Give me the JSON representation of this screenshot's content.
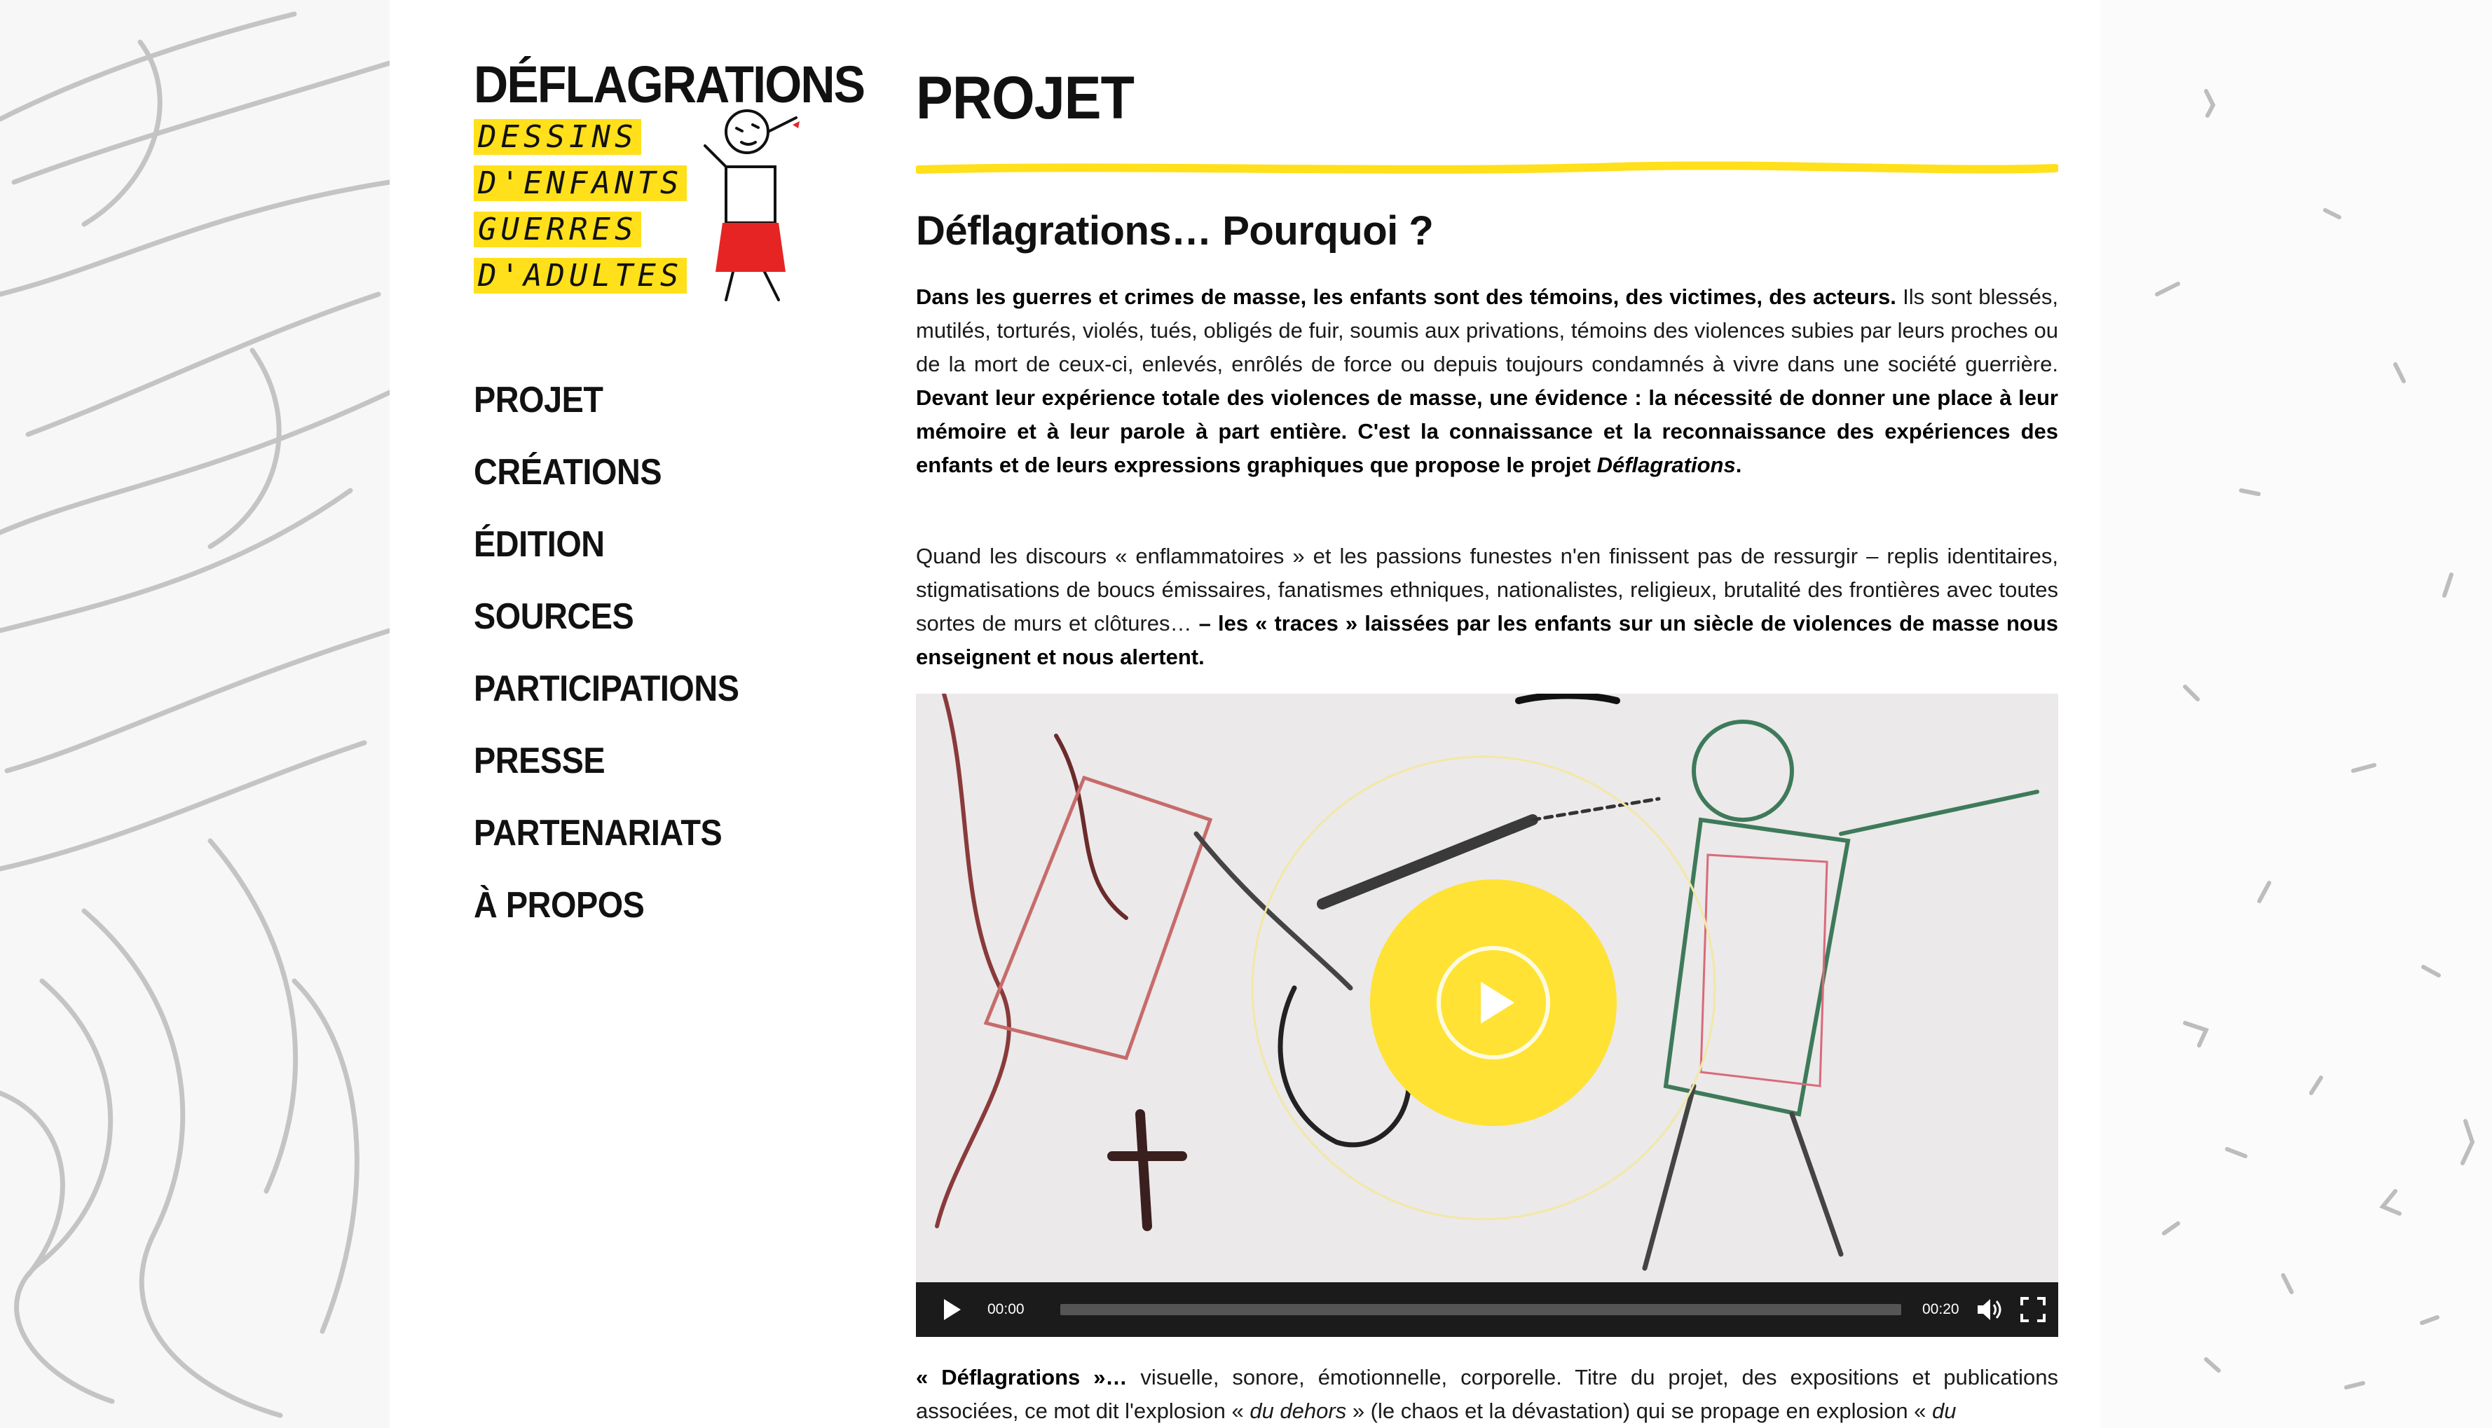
{
  "brand": {
    "title": "DÉFLAGRATIONS",
    "tagline": [
      "DESSINS",
      "D'ENFANTS",
      "GUERRES",
      "D'ADULTES"
    ]
  },
  "nav": {
    "items": [
      {
        "label": "PROJET"
      },
      {
        "label": "CRÉATIONS"
      },
      {
        "label": "ÉDITION"
      },
      {
        "label": "SOURCES"
      },
      {
        "label": "PARTICIPATIONS"
      },
      {
        "label": "PRESSE"
      },
      {
        "label": "PARTENARIATS"
      },
      {
        "label": "À PROPOS"
      }
    ]
  },
  "main": {
    "page_title": "PROJET",
    "section_title": "Déflagrations… Pourquoi ?",
    "p1": {
      "b1": "Dans les guerres et crimes de masse, les enfants sont des témoins, des victimes, des acteurs.",
      "t1": " Ils sont blessés, mutilés, torturés, violés, tués, obligés de fuir, soumis aux privations, témoins des violences subies par leurs proches ou de la mort de ceux-ci, enlevés, enrôlés de force ou depuis toujours condamnés à vivre dans une société guerrière. ",
      "b2": "Devant leur expérience totale des violences de masse, une évidence : la nécessité de donner une place à leur mémoire et à leur parole à part entière. C'est la connaissance et la reconnaissance des expériences des enfants et de leurs expressions graphiques que propose le projet ",
      "b2i": "Déflagrations",
      "b2end": "."
    },
    "p2": {
      "t1": "Quand les discours « enflammatoires » et les passions funestes n'en finissent pas de ressurgir – replis identitaires, stigmatisations de boucs émissaires, fanatismes ethniques, nationalistes, religieux, brutalité des frontières avec toutes sortes de murs et clôtures… ",
      "b1": "– les « traces » laissées par les enfants sur un siècle de violences de masse nous enseignent et nous alertent."
    },
    "video": {
      "current_time": "00:00",
      "duration": "00:20",
      "progress": 0
    },
    "p3": {
      "b1": "« Déflagrations »…",
      "t1": " visuelle, sonore, émotionnelle, corporelle. Titre du projet, des expositions et publications associées, ce mot dit l'explosion « ",
      "i1": "du dehors",
      "t2": " » (le chaos et la dévastation) qui se propage en explosion « ",
      "i2": "du"
    }
  },
  "colors": {
    "accent_yellow": "#ffe233",
    "text": "#111111",
    "player_bar": "#1b1b1b"
  }
}
